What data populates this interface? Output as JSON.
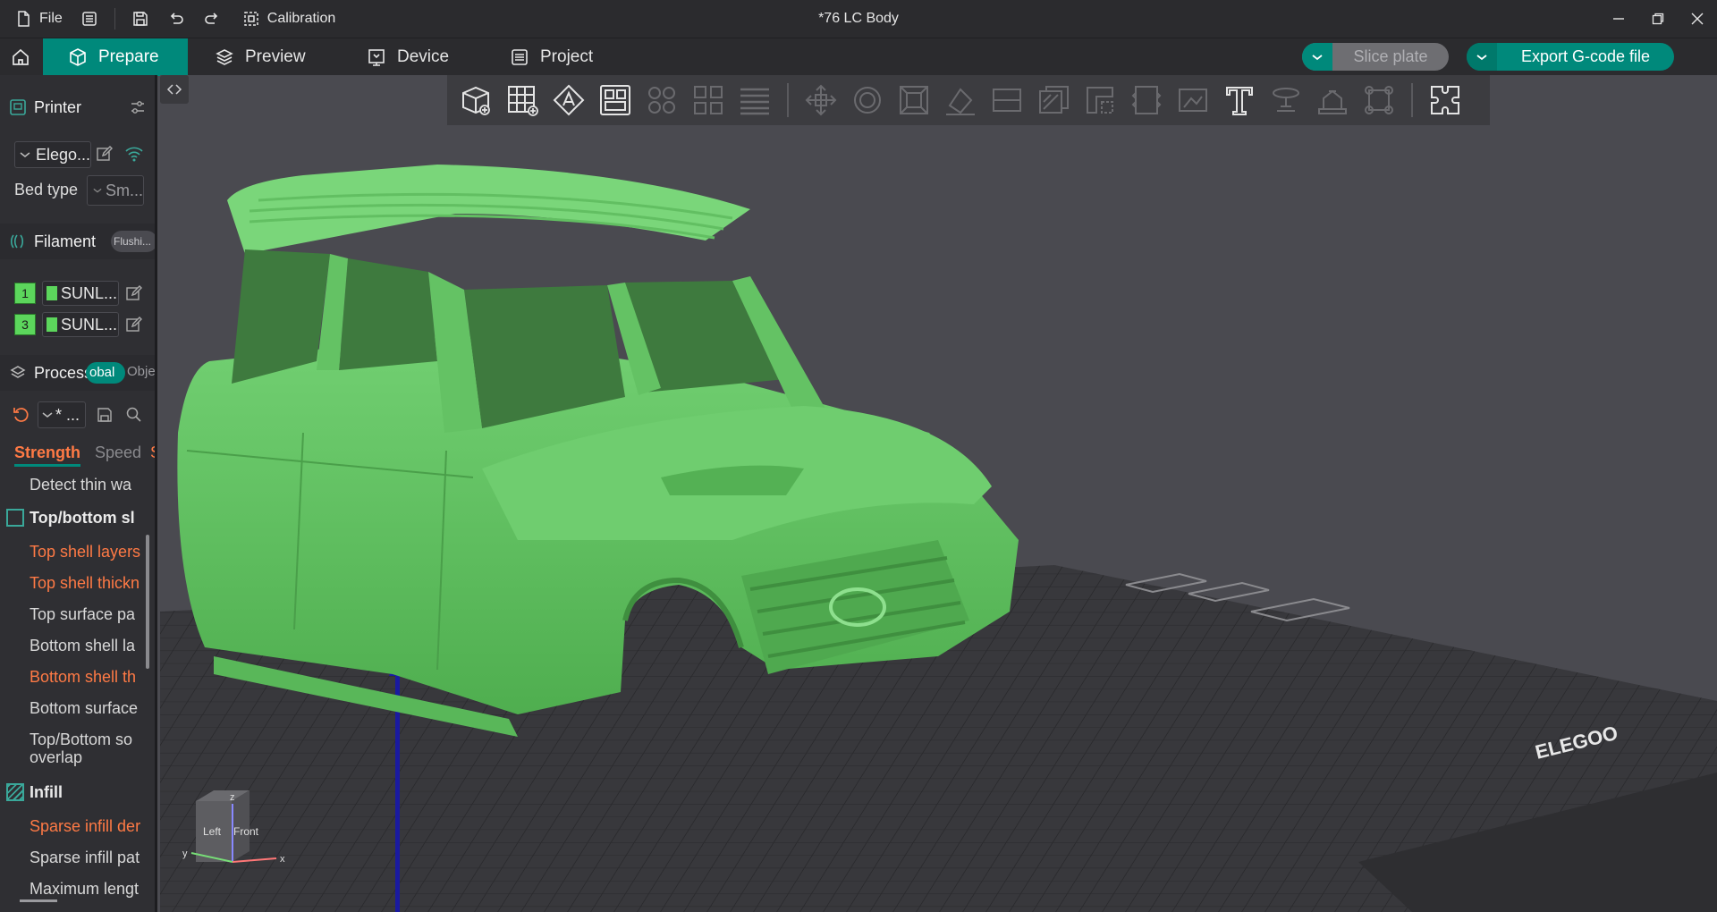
{
  "titlebar": {
    "file_label": "File",
    "calibration_label": "Calibration",
    "window_title": "*76 LC Body"
  },
  "tabs": {
    "prepare": "Prepare",
    "preview": "Preview",
    "device": "Device",
    "project": "Project"
  },
  "actions": {
    "slice_plate": "Slice plate",
    "export_gcode": "Export G-code file"
  },
  "printer": {
    "header": "Printer",
    "selected": "Elego...",
    "bed_type_label": "Bed type",
    "bed_type_value": "Sm..."
  },
  "filament": {
    "header": "Filament",
    "flush_button": "Flushi...",
    "items": [
      {
        "num": "1",
        "name": "SUNL..."
      },
      {
        "num": "3",
        "name": "SUNL..."
      }
    ]
  },
  "process": {
    "header": "Process",
    "global_toggle": "obal",
    "object_toggle": "Obje",
    "preset_value": "* ...",
    "tabs": [
      "Strength",
      "Speed",
      "S"
    ]
  },
  "settings": {
    "detect_thin_wall": "Detect thin wa",
    "group_top_bottom": "Top/bottom sl",
    "top_shell_layers": "Top shell layers",
    "top_shell_thickness": "Top shell thickn",
    "top_surface_pattern": "Top surface pa",
    "bottom_shell_layers": "Bottom shell la",
    "bottom_shell_thickness": "Bottom shell th",
    "bottom_surface_pattern": "Bottom surface",
    "top_bottom_solid_overlap_1": "Top/Bottom so",
    "top_bottom_solid_overlap_2": "overlap",
    "group_infill": "Infill",
    "sparse_infill_density": "Sparse infill der",
    "sparse_infill_pattern": "Sparse infill pat",
    "maximum_length": "Maximum lengt"
  },
  "viewport": {
    "bed_brand": "ELEGOO",
    "model_color": "#5cc45c",
    "axis_labels": {
      "z": "z",
      "x": "x",
      "y": "y"
    },
    "cube_faces": {
      "left": "Left",
      "front": "Front"
    }
  },
  "colors": {
    "accent": "#00897b",
    "modified": "#ff7a45"
  }
}
